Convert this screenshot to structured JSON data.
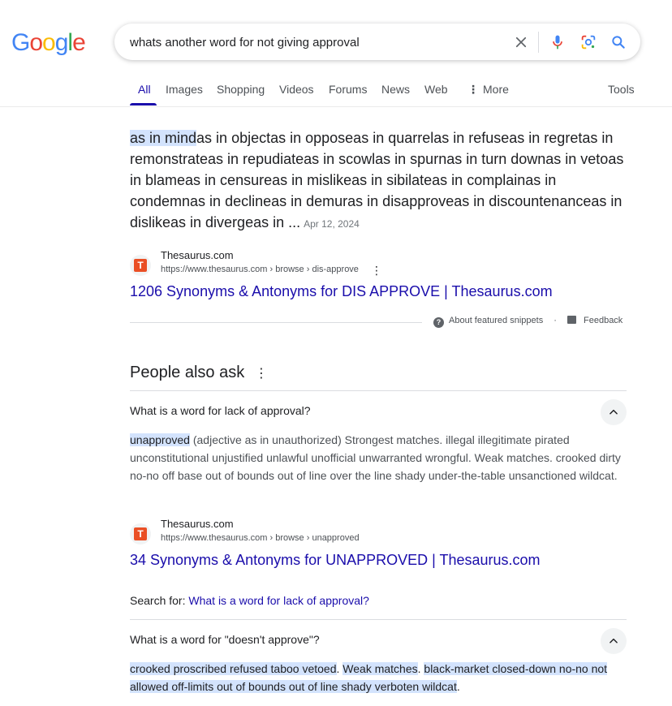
{
  "header": {
    "logo_text": [
      "G",
      "o",
      "o",
      "g",
      "l",
      "e"
    ],
    "logo_colors": [
      "#4285F4",
      "#EA4335",
      "#FBBC05",
      "#4285F4",
      "#34A853",
      "#EA4335"
    ],
    "search_query": "whats another word for not giving approval",
    "icons": [
      "clear-icon",
      "mic-icon",
      "lens-icon",
      "search-icon"
    ]
  },
  "tabs": {
    "items": [
      "All",
      "Images",
      "Shopping",
      "Videos",
      "Forums",
      "News",
      "Web",
      "More"
    ],
    "active": "All",
    "tools_label": "Tools"
  },
  "featured_snippet": {
    "highlight": "as in mind",
    "text": "as in objectas in opposeas in quarrelas in refuseas in regretas in remonstrateas in repudiateas in scowlas in spurnas in turn downas in vetoas in blameas in censureas in mislikeas in sibilateas in complainas in condemnas in declineas in demuras in disapproveas in discountenanceas in dislikeas in divergeas in ...",
    "date": "Apr 12, 2024",
    "source": {
      "site": "Thesaurus.com",
      "url": "https://www.thesaurus.com › browse › dis-approve",
      "title": "1206 Synonyms & Antonyms for DIS APPROVE | Thesaurus.com"
    },
    "about_label": "About featured snippets",
    "separator": "·",
    "feedback_label": "Feedback"
  },
  "paa": {
    "title": "People also ask",
    "questions": [
      {
        "question": "What is a word for lack of approval?",
        "answer_highlight": "unapproved",
        "answer_rest": " (adjective as in unauthorized) Strongest matches. illegal illegitimate pirated unconstitutional unjustified unlawful unofficial unwarranted wrongful. Weak matches. crooked dirty no-no off base out of bounds out of line over the line shady under-the-table unsanctioned wildcat.",
        "source": {
          "site": "Thesaurus.com",
          "url": "https://www.thesaurus.com › browse › unapproved",
          "title": "34 Synonyms & Antonyms for UNAPPROVED | Thesaurus.com"
        },
        "search_for_label": "Search for:",
        "search_for_link": "What is a word for lack of approval?"
      },
      {
        "question": "What is a word for \"doesn't approve\"?",
        "answer_part1": "crooked proscribed refused taboo vetoed",
        "answer_dot1": ".",
        "answer_part2": "Weak matches",
        "answer_dot2": ".",
        "answer_part3": "black-market closed-down no-no not allowed off-limits out of bounds out of line shady verboten wildcat",
        "answer_dot3": "."
      }
    ]
  }
}
